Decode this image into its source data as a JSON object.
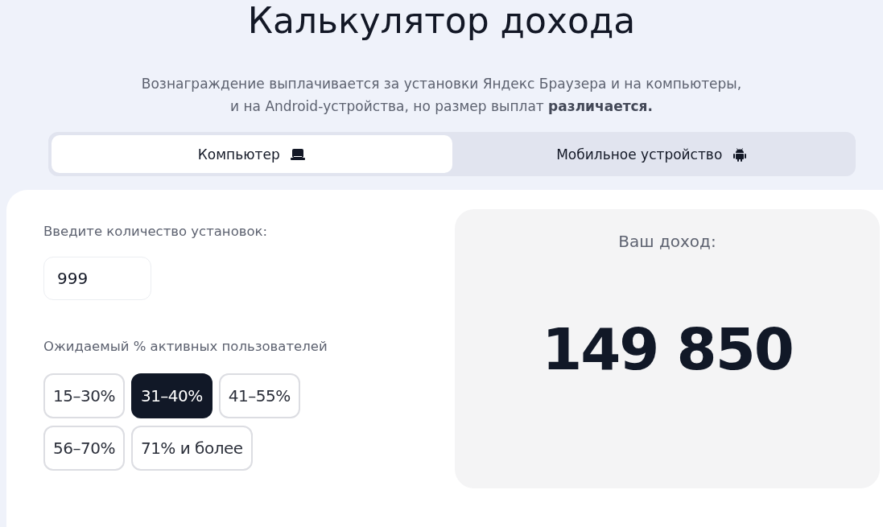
{
  "title": "Калькулятор дохода",
  "description": "Вознаграждение выплачивается за установки Яндекс Браузера и на компьютеры,\nи на Android-устройства, но размер выплат **различается.**",
  "tabs": [
    {
      "label": "Компьютер",
      "kind": "laptop",
      "selected": true
    },
    {
      "label": "Мобильное устройство",
      "kind": "android",
      "selected": false
    }
  ],
  "installs": {
    "label": "Введите количество установок:",
    "value": "999"
  },
  "active_users": {
    "label": "Ожидаемый % активных пользователей",
    "options": [
      {
        "label": "15–30%",
        "selected": false
      },
      {
        "label": "31–40%",
        "selected": true
      },
      {
        "label": "41–55%",
        "selected": false
      },
      {
        "label": "56–70%",
        "selected": false
      },
      {
        "label": "71% и более",
        "selected": false
      }
    ]
  },
  "income": {
    "label": "Ваш доход:",
    "value": "149 850"
  }
}
